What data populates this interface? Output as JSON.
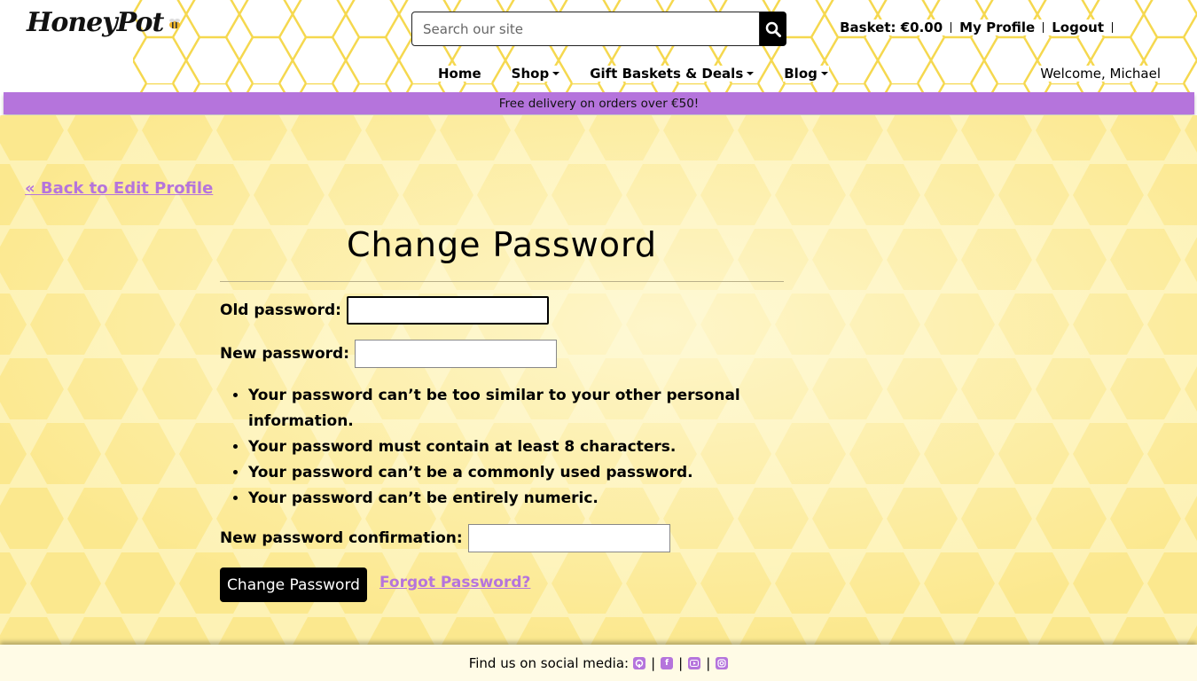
{
  "header": {
    "logo_text": "HoneyPot",
    "search": {
      "placeholder": "Search our site",
      "value": ""
    },
    "account": {
      "basket": "Basket: €0.00",
      "profile": "My Profile",
      "logout": "Logout"
    },
    "nav": {
      "home": "Home",
      "shop": "Shop",
      "gift": "Gift Baskets & Deals",
      "blog": "Blog"
    },
    "welcome": "Welcome, Michael"
  },
  "promo": {
    "text": "Free delivery on orders over €50!"
  },
  "main": {
    "back_link": "« Back to Edit Profile",
    "title": "Change Password",
    "fields": {
      "old_label": "Old password:",
      "new_label": "New password:",
      "confirm_label": "New password confirmation:"
    },
    "help_text": [
      "Your password can’t be too similar to your other personal information.",
      "Your password must contain at least 8 characters.",
      "Your password can’t be a commonly used password.",
      "Your password can’t be entirely numeric."
    ],
    "submit": "Change Password",
    "forgot": "Forgot Password?"
  },
  "footer": {
    "text": "Find us on social media:",
    "social_icons": [
      "github-icon",
      "facebook-icon",
      "youtube-icon",
      "instagram-icon"
    ]
  },
  "colors": {
    "accent_purple": "#b574dc",
    "honey_yellow": "#fdf1b0",
    "hex_outline": "#f5d43c"
  }
}
